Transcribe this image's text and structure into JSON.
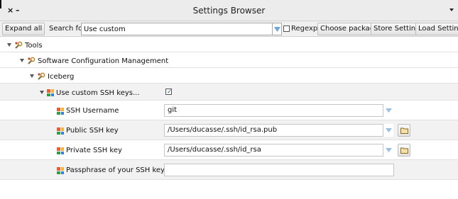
{
  "window": {
    "title": "Settings Browser"
  },
  "toolbar": {
    "expand_all": "Expand all",
    "search_label": "Search for:",
    "search_value": "Use custom",
    "regexp_label": "Regexp",
    "choose_packages": "Choose packages",
    "store_settings": "Store Settings",
    "load_settings": "Load Settings"
  },
  "tree": {
    "tools": "Tools",
    "scm": "Software Configuration Management",
    "iceberg": "Iceberg",
    "use_custom": "Use custom SSH keys...",
    "ssh_username": {
      "label": "SSH Username",
      "value": "git"
    },
    "public_key": {
      "label": "Public SSH key",
      "value": "/Users/ducasse/.ssh/id_rsa.pub"
    },
    "private_key": {
      "label": "Private SSH key",
      "value": "/Users/ducasse/.ssh/id_rsa"
    },
    "passphrase": {
      "label": "Passphrase of your SSH key",
      "value": ""
    }
  }
}
